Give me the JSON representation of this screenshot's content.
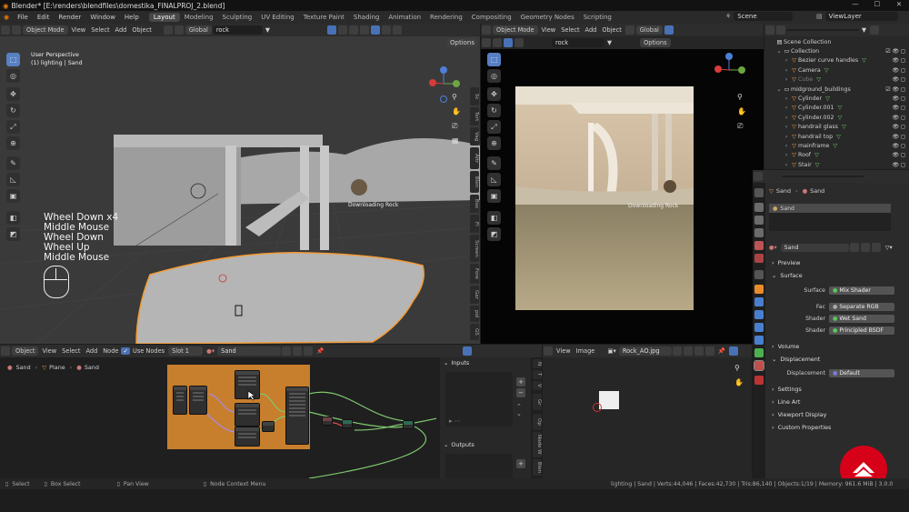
{
  "window_title": "Blender* [E:\\renders\\blendfiles\\domestika_FINALPROJ_2.blend]",
  "menu": [
    "File",
    "Edit",
    "Render",
    "Window",
    "Help"
  ],
  "workspaces": [
    "Layout",
    "Modeling",
    "Sculpting",
    "UV Editing",
    "Texture Paint",
    "Shading",
    "Animation",
    "Rendering",
    "Compositing",
    "Geometry Nodes",
    "Scripting"
  ],
  "scene": "Scene",
  "view_layer": "ViewLayer",
  "viewport_left": {
    "mode": "Object Mode",
    "menus": [
      "View",
      "Select",
      "Add",
      "Object"
    ],
    "transform": "Global",
    "search": "rock",
    "options": "Options",
    "overlay_title": "User Perspective",
    "overlay_sub": "(1) lighting | Sand",
    "label_rock": "Downloading Rock",
    "side_tabs": [
      "Sc",
      "Tert",
      "Vag",
      "Attr",
      "Blen",
      "Box",
      "Fl",
      "Screen",
      "Fore",
      "Gar",
      "pol",
      "GS"
    ],
    "key_log": [
      "Wheel Down x4",
      "Middle Mouse",
      "Wheel Down",
      "Wheel Up",
      "Middle Mouse"
    ]
  },
  "viewport_right": {
    "mode": "Object Mode",
    "menus": [
      "View",
      "Select",
      "Add",
      "Object"
    ],
    "transform": "Global",
    "search": "rock",
    "options": "Options",
    "label_rock": "Downloading Rock"
  },
  "outliner": {
    "search": "",
    "rows": [
      {
        "name": "Scene Collection",
        "indent": 0,
        "type": "scene"
      },
      {
        "name": "Collection",
        "indent": 1,
        "type": "coll"
      },
      {
        "name": "Bezier curve handles",
        "indent": 2,
        "type": "obj"
      },
      {
        "name": "Camera",
        "indent": 2,
        "type": "obj"
      },
      {
        "name": "Cube",
        "indent": 2,
        "type": "obj",
        "dim": true
      },
      {
        "name": "midground_buildings",
        "indent": 1,
        "type": "coll"
      },
      {
        "name": "Cylinder",
        "indent": 2,
        "type": "obj"
      },
      {
        "name": "Cylinder.001",
        "indent": 2,
        "type": "obj"
      },
      {
        "name": "Cylinder.002",
        "indent": 2,
        "type": "obj"
      },
      {
        "name": "handrail glass",
        "indent": 2,
        "type": "obj"
      },
      {
        "name": "handrail top",
        "indent": 2,
        "type": "obj"
      },
      {
        "name": "mainframe",
        "indent": 2,
        "type": "obj"
      },
      {
        "name": "Roof",
        "indent": 2,
        "type": "obj"
      },
      {
        "name": "Stair",
        "indent": 2,
        "type": "obj"
      }
    ]
  },
  "properties": {
    "breadcrumb_obj": "Sand",
    "breadcrumb_mat": "Sand",
    "slot": "Sand",
    "material": "Sand",
    "sections": {
      "preview": "Preview",
      "surface": "Surface",
      "volume": "Volume",
      "displacement": "Displacement",
      "settings": "Settings",
      "line_art": "Line Art",
      "viewport_display": "Viewport Display",
      "custom_properties": "Custom Properties"
    },
    "surface_label": "Surface",
    "surface_value": "Mix Shader",
    "fac_label": "Fac",
    "fac_value": "Separate RGB",
    "shader1_label": "Shader",
    "shader1_value": "Wet Sand",
    "shader2_label": "Shader",
    "shader2_value": "Principled BSDF",
    "disp_label": "Displacement",
    "disp_value": "Default"
  },
  "node_editor": {
    "type": "Object",
    "menus": [
      "View",
      "Select",
      "Add",
      "Node"
    ],
    "use_nodes": "Use Nodes",
    "slot": "Slot 1",
    "material": "Sand",
    "breadcrumb": [
      "Sand",
      "Plane",
      "Sand"
    ],
    "inputs": "Inputs",
    "outputs": "Outputs",
    "side_tabs": [
      "N",
      "T",
      "V",
      "Gr",
      "Op",
      "Node W",
      "Blen"
    ]
  },
  "image_editor": {
    "menus": [
      "View",
      "Image"
    ],
    "image": "Rock_AO.jpg"
  },
  "statusbar": {
    "select": "Select",
    "box_select": "Box Select",
    "pan_view": "Pan View",
    "node_context": "Node Context Menu",
    "stats": "lighting | Sand | Verts:44,046 | Faces:42,730 | Tris:86,140 | Objects:1/19 | Memory: 961.6 MiB | 3.0.0"
  },
  "colors": {
    "accent": "#4872b5",
    "selection": "#f29b37",
    "logo": "#d60019"
  }
}
